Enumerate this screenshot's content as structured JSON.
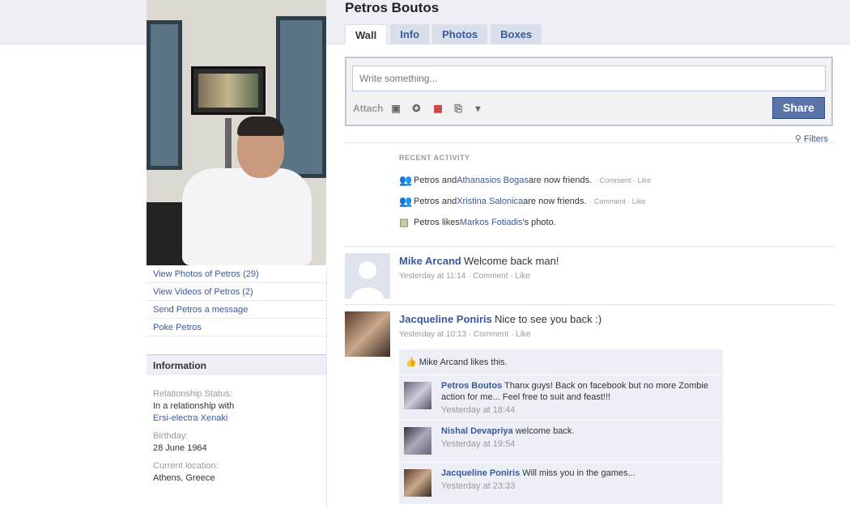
{
  "profile": {
    "name": "Petros Boutos",
    "links": [
      "View Photos of Petros (29)",
      "View Videos of Petros (2)",
      "Send Petros a message",
      "Poke Petros"
    ]
  },
  "info": {
    "heading": "Information",
    "relationship_label": "Relationship Status:",
    "relationship_value": "In a relationship with",
    "relationship_partner": "Ersi-electra Xenaki",
    "birthday_label": "Birthday:",
    "birthday_value": "28 June 1964",
    "location_label": "Current location:",
    "location_value": "Athens, Greece"
  },
  "tabs": [
    "Wall",
    "Info",
    "Photos",
    "Boxes"
  ],
  "publisher": {
    "placeholder": "Write something...",
    "attach_label": "Attach",
    "share_label": "Share"
  },
  "filters_label": "Filters",
  "recent": {
    "heading": "RECENT ACTIVITY",
    "items": [
      {
        "pre": "Petros and ",
        "link": "Athanasios Bogas",
        "post": " are now friends.",
        "actions": "· Comment · Like"
      },
      {
        "pre": "Petros and ",
        "link": "Xristina Salonica",
        "post": " are now friends.",
        "actions": "· Comment · Like"
      },
      {
        "pre": "Petros likes ",
        "link": "Markos Fotiadis",
        "post": "'s photo.",
        "actions": ""
      }
    ]
  },
  "posts": [
    {
      "author": "Mike Arcand",
      "text": "Welcome back man!",
      "meta": "Yesterday at 11:14 · Comment · Like"
    },
    {
      "author": "Jacqueline Poniris",
      "text": "Nice to see you back :)",
      "meta": "Yesterday at 10:13 · Comment · Like"
    }
  ],
  "likes_text": "Mike Arcand likes this.",
  "comments": [
    {
      "author": "Petros Boutos",
      "text": "Thanx guys! Back on facebook but no more Zombie action for me... Feel free to suit and feast!!!",
      "meta": "Yesterday at 18:44"
    },
    {
      "author": "Nishal Devapriya",
      "text": "welcome back.",
      "meta": "Yesterday at 19:54"
    },
    {
      "author": "Jacqueline Poniris",
      "text": "Will miss you in the games...",
      "meta": "Yesterday at 23:33"
    }
  ],
  "colors": {
    "link": "#3b5998",
    "share_button": "#5b74a8",
    "tab_bg": "#d8dfea"
  }
}
